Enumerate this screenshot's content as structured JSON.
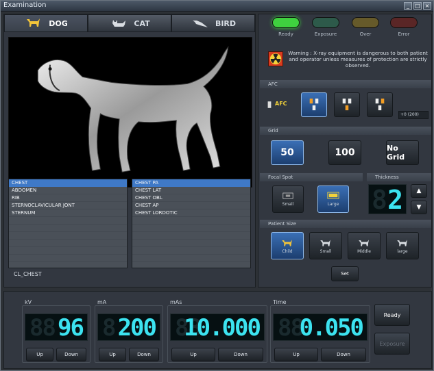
{
  "window": {
    "title": "Examination"
  },
  "tabs": [
    {
      "label": "DOG"
    },
    {
      "label": "CAT"
    },
    {
      "label": "BIRD"
    }
  ],
  "regions_list": [
    "CHEST",
    "ABDOMEN",
    "RIB",
    "STERNOCLAVICULAR JONT",
    "STERNUM"
  ],
  "views_list": [
    "CHEST PA",
    "CHEST LAT",
    "CHEST OBL",
    "CHEST AP",
    "CHEST LORDOTIC"
  ],
  "status_text": "CL_CHEST",
  "lights": [
    {
      "label": "Ready",
      "color": "#3fd13f"
    },
    {
      "label": "Exposure",
      "color": "#2d5a4a"
    },
    {
      "label": "Over",
      "color": "#665a2a"
    },
    {
      "label": "Error",
      "color": "#5a2626"
    }
  ],
  "warning_text": "Warning : X-ray equipment is dangerous to both patient and operator unless measures of protection are strictly observed.",
  "afc": {
    "section": "AFC",
    "label": "AFC",
    "value": "+0 (200)"
  },
  "grid": {
    "section": "Grid",
    "options": [
      "50",
      "100",
      "No Grid"
    ],
    "selected": "50"
  },
  "focal_spot": {
    "section": "Focal Spot",
    "small": "Small",
    "large": "Large",
    "selected": "Large"
  },
  "thickness": {
    "section": "Thickness",
    "value": "2"
  },
  "patient_size": {
    "section": "Patient Size",
    "options": [
      "Child",
      "Small",
      "Middle",
      "large"
    ],
    "selected": "Child"
  },
  "set_label": "Set",
  "kv": {
    "label": "kV",
    "value": "96",
    "ghost": "88"
  },
  "ma": {
    "label": "mA",
    "value": "200",
    "ghost": "8"
  },
  "mas": {
    "label": "mAs",
    "value": "10.000",
    "ghost": "88"
  },
  "time": {
    "label": "Time",
    "value": "0.050",
    "ghost": "88"
  },
  "up_label": "Up",
  "down_label": "Down",
  "ready_label": "Ready",
  "exposure_label": "Exposure"
}
